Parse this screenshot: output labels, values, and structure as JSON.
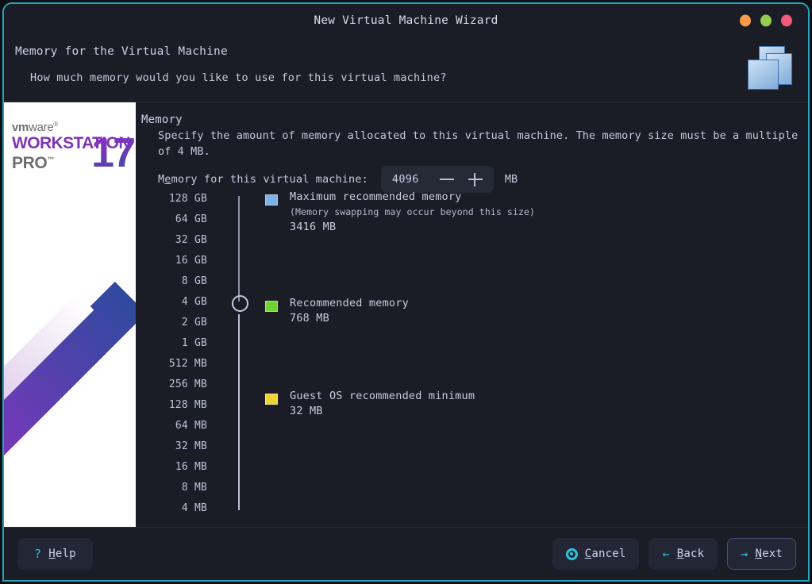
{
  "window": {
    "title": "New Virtual Machine Wizard",
    "controls": [
      {
        "name": "minimize",
        "color": "#f79a4b"
      },
      {
        "name": "maximize",
        "color": "#96cc4f"
      },
      {
        "name": "close",
        "color": "#f4577a"
      }
    ]
  },
  "header": {
    "title": "Memory for the Virtual Machine",
    "subtitle": "How much memory would you like to use for this virtual machine?",
    "icon": "stacked-windows-icon"
  },
  "sidebar": {
    "brand_vendor_bold": "vm",
    "brand_vendor_light": "ware",
    "brand_vendor_tm": "®",
    "brand_product": "WORKSTATION",
    "brand_edition": "PRO",
    "brand_edition_tm": "™",
    "brand_version": "17"
  },
  "main": {
    "section_title": "Memory",
    "description": "Specify the amount of memory allocated to this virtual machine. The memory size must be a multiple of 4 MB.",
    "memory_label_pre": "M",
    "memory_label_acc": "e",
    "memory_label_post": "mory for this virtual machine:",
    "memory_value": "4096",
    "memory_unit": "MB",
    "decrement_label": "−",
    "increment_label": "+",
    "scale_ticks": [
      "128 GB",
      "64 GB",
      "32 GB",
      "16 GB",
      "8 GB",
      "4 GB",
      "2 GB",
      "1 GB",
      "512 MB",
      "256 MB",
      "128 MB",
      "64 MB",
      "32 MB",
      "16 MB",
      "8 MB",
      "4 MB"
    ],
    "slider_position_label": "4 GB",
    "legend": [
      {
        "swatch_color": "#7eb2e3",
        "title": "Maximum recommended memory",
        "note": "(Memory swapping may occur beyond this size)",
        "value": "3416 MB"
      },
      {
        "swatch_color": "#6fd232",
        "title": "Recommended memory",
        "note": "",
        "value": "768 MB"
      },
      {
        "swatch_color": "#ecd534",
        "title": "Guest OS recommended minimum",
        "note": "",
        "value": "32 MB"
      }
    ]
  },
  "footer": {
    "help": {
      "icon": "question-mark-icon",
      "glyph": "?",
      "label_acc": "H",
      "label_rest": "elp"
    },
    "cancel": {
      "icon": "target-icon",
      "label_acc": "C",
      "label_rest": "ancel"
    },
    "back": {
      "icon": "arrow-left-icon",
      "glyph": "←",
      "label_acc": "B",
      "label_rest": "ack"
    },
    "next": {
      "icon": "arrow-right-icon",
      "glyph": "→",
      "label_acc": "N",
      "label_rest": "ext"
    }
  },
  "colors": {
    "window_border": "#2aa3bd",
    "panel_bg": "#1b1d26",
    "accent_cyan": "#2ec4dc",
    "brand_purple": "#7f35b2"
  }
}
